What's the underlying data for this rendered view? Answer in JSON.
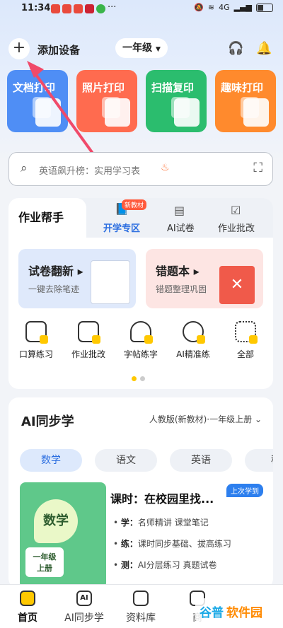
{
  "status": {
    "time": "11:34",
    "network": "4G",
    "battery": "▮"
  },
  "header": {
    "add_label": "添加设备",
    "grade": "一年级"
  },
  "tiles": [
    {
      "label": "文档打印",
      "color": "#4f8ef5"
    },
    {
      "label": "照片打印",
      "color": "#ff6b4f"
    },
    {
      "label": "扫描复印",
      "color": "#2bbd6e"
    },
    {
      "label": "趣味打印",
      "color": "#ff8a2d"
    }
  ],
  "search": {
    "placeholder": "英语飙升榜：实用学习表"
  },
  "helper": {
    "tabs": [
      "作业帮手",
      "开学专区",
      "AI试卷",
      "作业批改"
    ],
    "new_badge": "新教材",
    "promos": [
      {
        "title": "试卷翻新",
        "subtitle": "一键去除笔迹"
      },
      {
        "title": "错题本",
        "subtitle": "错题整理巩固"
      }
    ],
    "quick": [
      "口算练习",
      "作业批改",
      "字帖练字",
      "AI精准练",
      "全部"
    ]
  },
  "sync": {
    "title": "AI同步学",
    "version": "人教版(新教材)·一年级上册",
    "subjects": [
      "数学",
      "语文",
      "英语",
      "科"
    ],
    "book_title": "数学",
    "book_grade": "一年级",
    "book_volume": "上册",
    "lesson": "课时：在校园里找...",
    "lesson_badge": "上次学到",
    "bullets": [
      {
        "key": "学：",
        "text": "名师精讲 课堂笔记"
      },
      {
        "key": "练：",
        "text": "课时同步基础、拔高练习"
      },
      {
        "key": "测：",
        "text": "AI分层练习 真题试卷"
      }
    ]
  },
  "nav": [
    "首页",
    "AI同步学",
    "资料库",
    "商"
  ],
  "watermark": {
    "part1": "谷普",
    "part2": "软件园"
  }
}
